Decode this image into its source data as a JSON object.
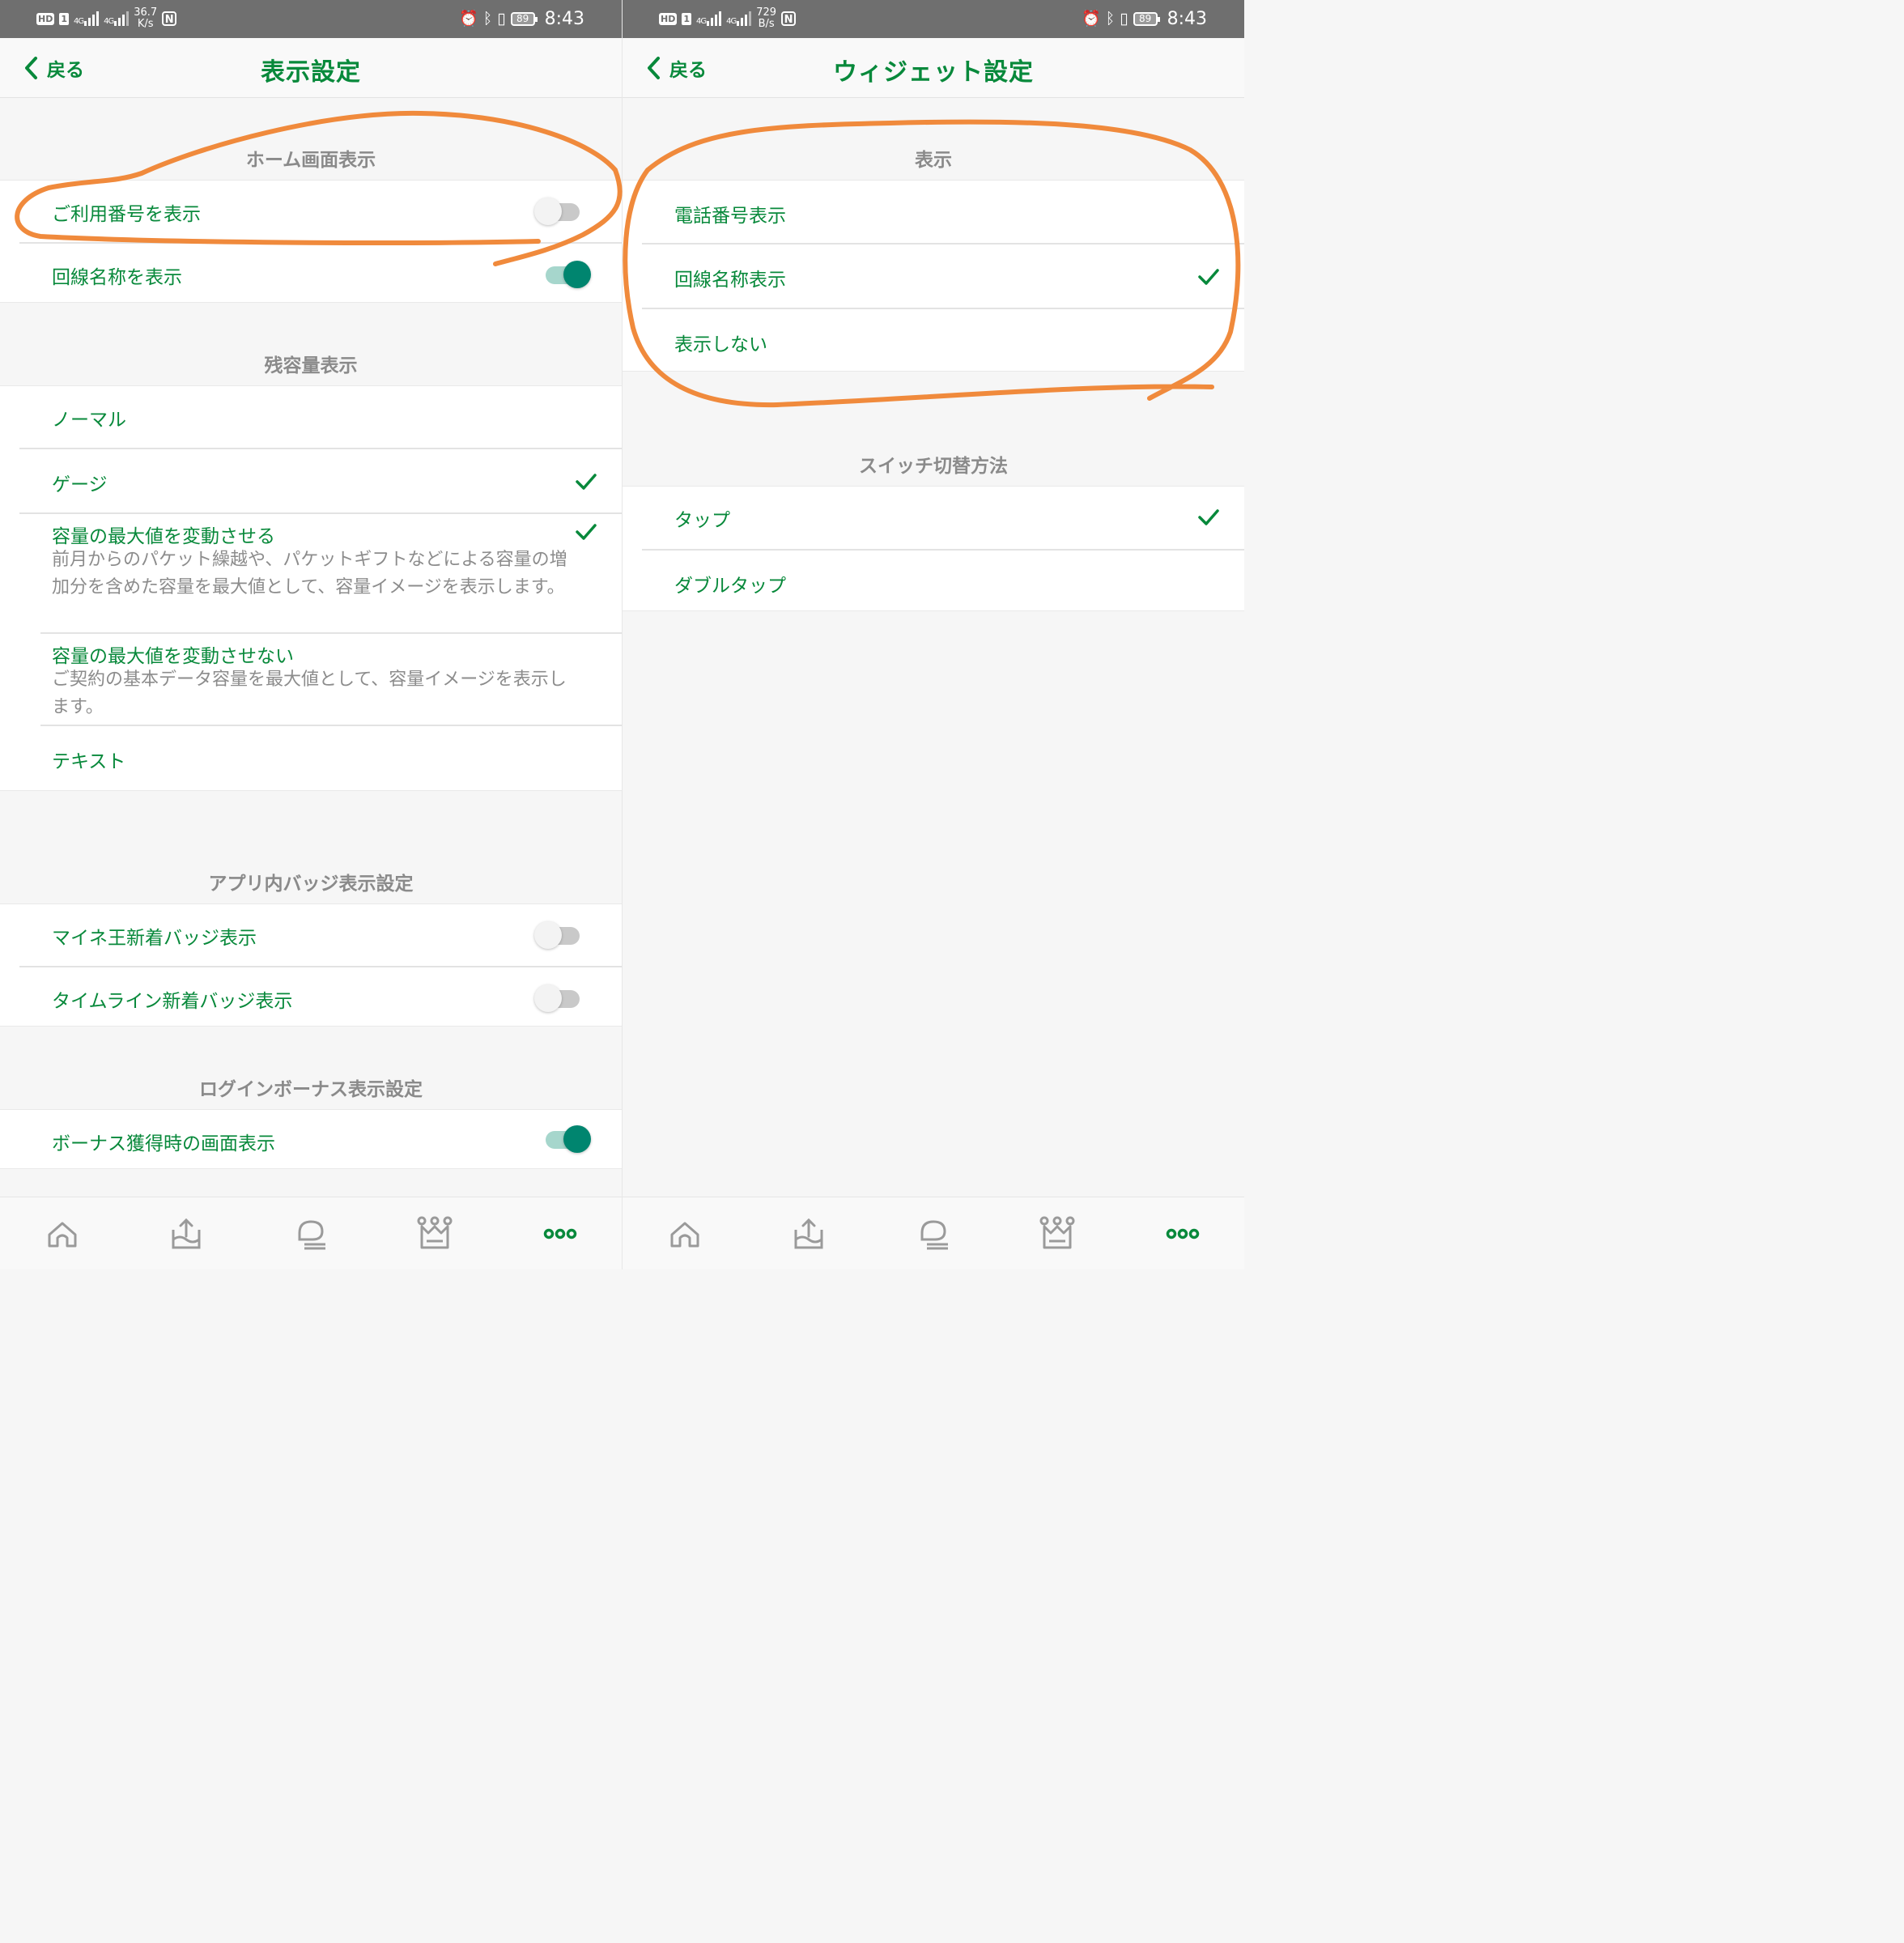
{
  "left": {
    "status": {
      "hd": "HD",
      "sim": "1",
      "net1": "4G",
      "net2": "4G",
      "speed_value": "36.7",
      "speed_unit": "K/s",
      "nfc": "N",
      "battery": "89",
      "time": "8:43"
    },
    "header": {
      "back_label": "戻る",
      "title": "表示設定"
    },
    "sections": {
      "home": {
        "title": "ホーム画面表示",
        "rows": [
          {
            "label": "ご利用番号を表示",
            "toggle": "off"
          },
          {
            "label": "回線名称を表示",
            "toggle": "on"
          }
        ]
      },
      "capacity": {
        "title": "残容量表示",
        "rows": [
          {
            "label": "ノーマル"
          },
          {
            "label": "ゲージ",
            "checked": true
          },
          {
            "label": "容量の最大値を変動させる",
            "checked": true,
            "desc": "前月からのパケット繰越や、パケットギフトなどによる容量の増加分を含めた容量を最大値として、容量イメージを表示します。"
          },
          {
            "label": "容量の最大値を変動させない",
            "desc": "ご契約の基本データ容量を最大値として、容量イメージを表示します。"
          },
          {
            "label": "テキスト"
          }
        ]
      },
      "badge": {
        "title": "アプリ内バッジ表示設定",
        "rows": [
          {
            "label": "マイネ王新着バッジ表示",
            "toggle": "off"
          },
          {
            "label": "タイムライン新着バッジ表示",
            "toggle": "off"
          }
        ]
      },
      "bonus": {
        "title": "ログインボーナス表示設定",
        "rows": [
          {
            "label": "ボーナス獲得時の画面表示",
            "toggle": "on"
          }
        ]
      }
    }
  },
  "right": {
    "status": {
      "hd": "HD",
      "sim": "1",
      "net1": "4G",
      "net2": "4G",
      "speed_value": "729",
      "speed_unit": "B/s",
      "nfc": "N",
      "battery": "89",
      "time": "8:43"
    },
    "header": {
      "back_label": "戻る",
      "title": "ウィジェット設定"
    },
    "sections": {
      "display": {
        "title": "表示",
        "rows": [
          {
            "label": "電話番号表示"
          },
          {
            "label": "回線名称表示",
            "checked": true
          },
          {
            "label": "表示しない"
          }
        ]
      },
      "switch": {
        "title": "スイッチ切替方法",
        "rows": [
          {
            "label": "タップ",
            "checked": true
          },
          {
            "label": "ダブルタップ"
          }
        ]
      }
    }
  },
  "nav": {
    "items": [
      {
        "icon": "home-icon"
      },
      {
        "icon": "data-charge-icon"
      },
      {
        "icon": "chat-bubble-icon"
      },
      {
        "icon": "crown-king-icon"
      },
      {
        "icon": "more-dots-icon",
        "active": true
      }
    ]
  },
  "colors": {
    "accent": "#08893b",
    "toggle_on": "#00856f",
    "annotation": "#f08a3c",
    "section_title": "#8a8a8a",
    "statusbar": "#6f6f6f"
  }
}
